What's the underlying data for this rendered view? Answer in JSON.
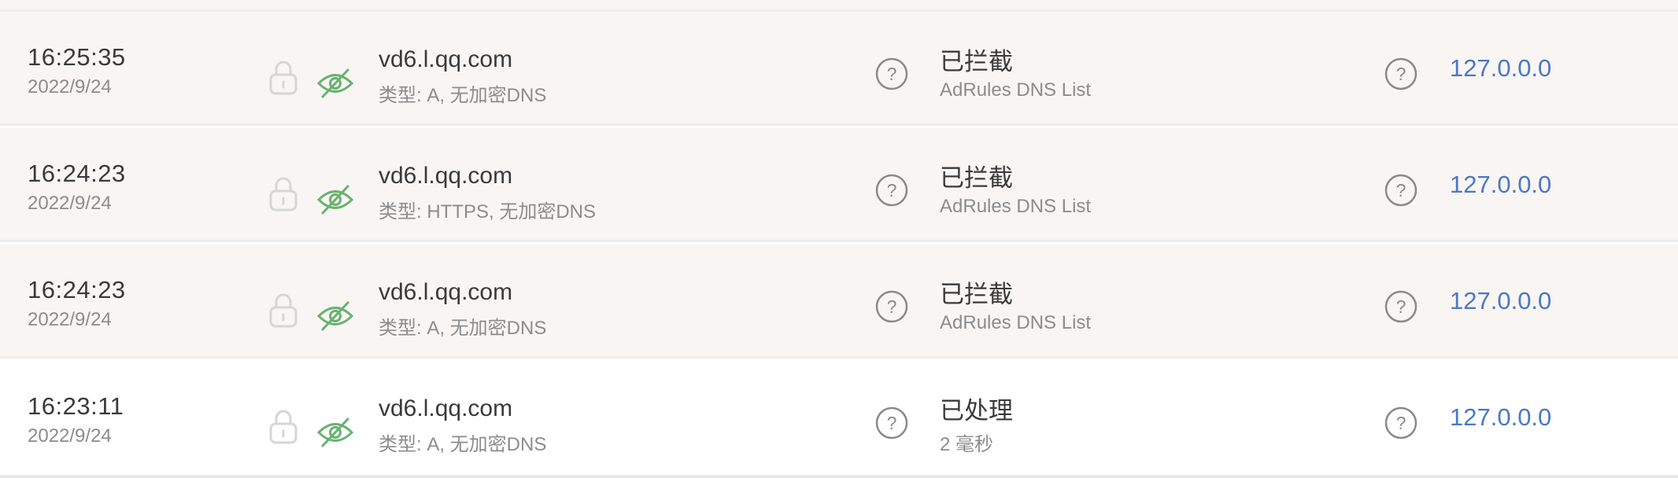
{
  "colors": {
    "blocked_row_bg": "#f9f5f3",
    "processed_row_bg": "#ffffff",
    "link": "#4a78c5",
    "eye_icon": "#67b26f",
    "lock_icon": "#d6d6d6",
    "help_icon": "#8a8a8a"
  },
  "icons": {
    "lock": "lock-icon",
    "eye": "eye-slash-icon",
    "help": "question-circle-icon"
  },
  "rows": [
    {
      "time": "16:25:35",
      "date": "2022/9/24",
      "domain": "vd6.l.qq.com",
      "query": "类型: A, 无加密DNS",
      "status": "已拦截",
      "substatus": "AdRules DNS List",
      "client": "127.0.0.0"
    },
    {
      "time": "16:24:23",
      "date": "2022/9/24",
      "domain": "vd6.l.qq.com",
      "query": "类型: HTTPS, 无加密DNS",
      "status": "已拦截",
      "substatus": "AdRules DNS List",
      "client": "127.0.0.0"
    },
    {
      "time": "16:24:23",
      "date": "2022/9/24",
      "domain": "vd6.l.qq.com",
      "query": "类型: A, 无加密DNS",
      "status": "已拦截",
      "substatus": "AdRules DNS List",
      "client": "127.0.0.0"
    },
    {
      "time": "16:23:11",
      "date": "2022/9/24",
      "domain": "vd6.l.qq.com",
      "query": "类型: A, 无加密DNS",
      "status": "已处理",
      "substatus": "2 毫秒",
      "client": "127.0.0.0"
    }
  ]
}
